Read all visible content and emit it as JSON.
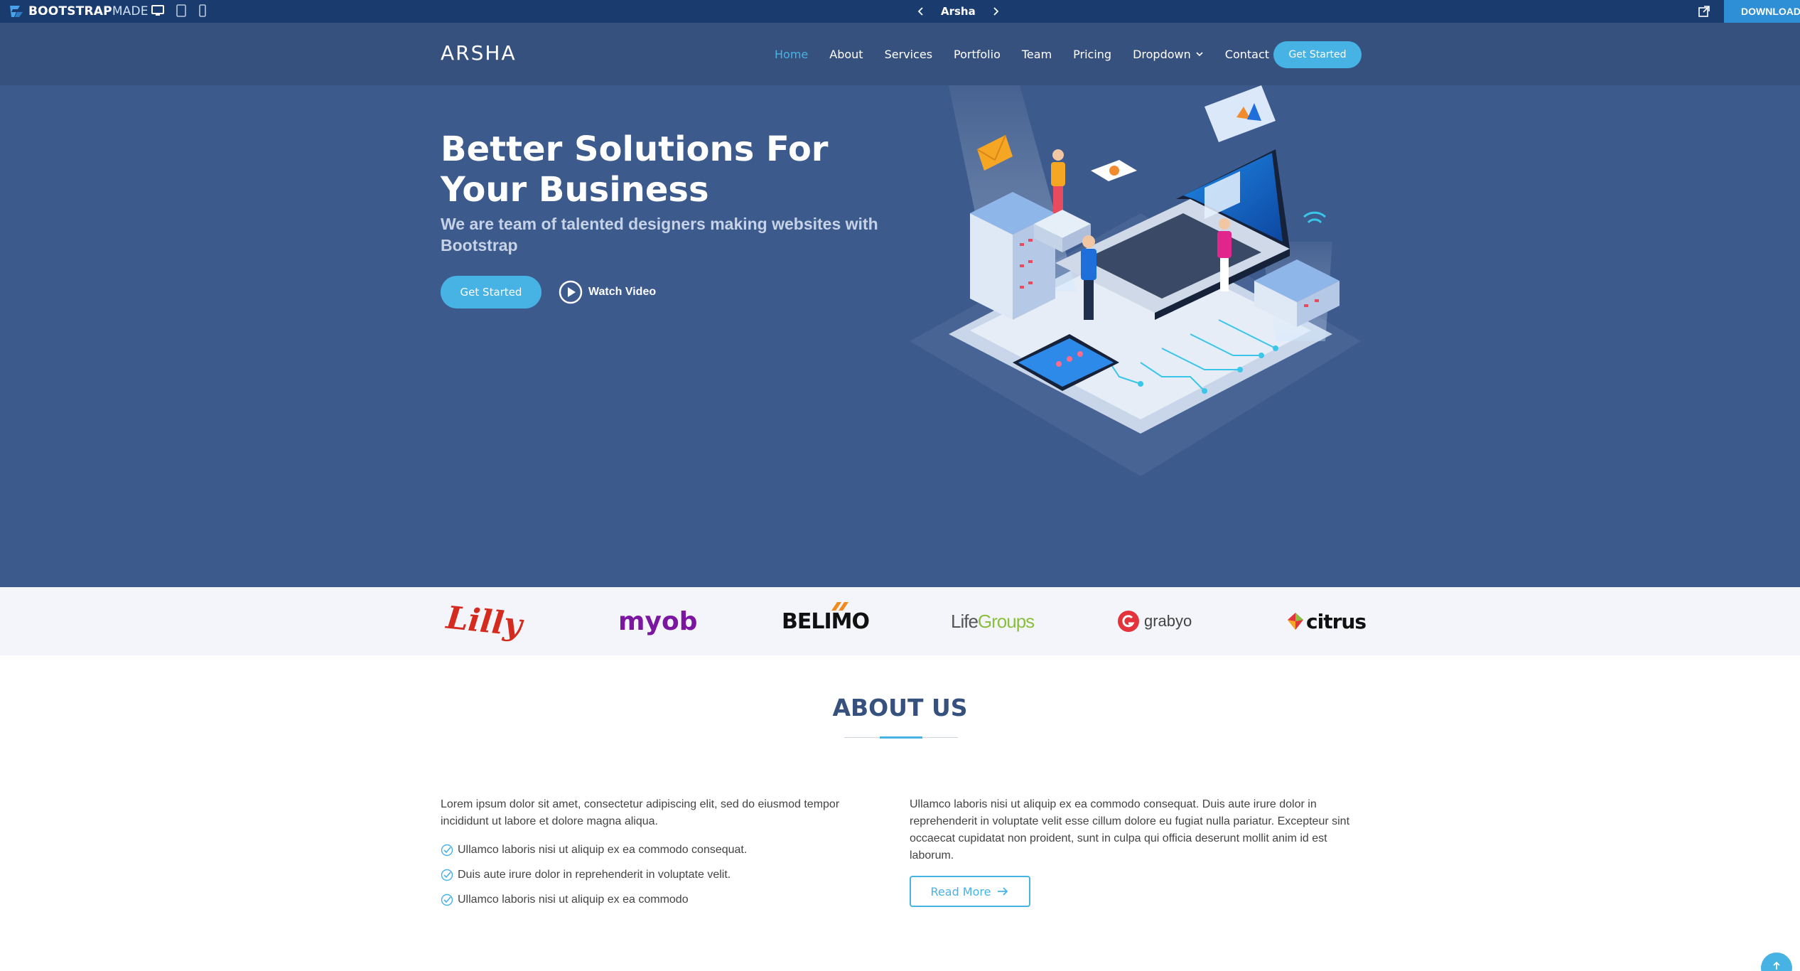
{
  "topbar": {
    "logo_bold": "BOOTSTRAP",
    "logo_light": "MADE",
    "template_name": "Arsha",
    "download_label": "DOWNLOAD",
    "colors": {
      "bar": "#1a3b6e",
      "download": "#2e8fd6"
    }
  },
  "header": {
    "brand": "ARSHA",
    "nav": [
      {
        "label": "Home",
        "active": true
      },
      {
        "label": "About"
      },
      {
        "label": "Services"
      },
      {
        "label": "Portfolio"
      },
      {
        "label": "Team"
      },
      {
        "label": "Pricing"
      },
      {
        "label": "Dropdown",
        "has_caret": true
      },
      {
        "label": "Contact"
      }
    ],
    "cta": "Get Started"
  },
  "hero": {
    "title": "Better Solutions For Your Business",
    "subtitle": "We are team of talented designers making websites with Bootstrap",
    "cta": "Get Started",
    "watch_video": "Watch Video"
  },
  "clients": [
    {
      "name": "Lilly",
      "color": "#d52b1e"
    },
    {
      "name": "myob",
      "color": "#7b16a1"
    },
    {
      "name": "BELIMO",
      "color": "#111111"
    },
    {
      "name": "Life",
      "name2": "Groups",
      "color": "#555555",
      "color2": "#8bbf3f"
    },
    {
      "name": "grabyo",
      "color": "#444444",
      "icon_letter": "G"
    },
    {
      "name": "citrus",
      "color": "#111111"
    }
  ],
  "about": {
    "title": "ABOUT US",
    "left_paragraph": "Lorem ipsum dolor sit amet, consectetur adipiscing elit, sed do eiusmod tempor incididunt ut labore et dolore magna aliqua.",
    "checks": [
      "Ullamco laboris nisi ut aliquip ex ea commodo consequat.",
      "Duis aute irure dolor in reprehenderit in voluptate velit.",
      "Ullamco laboris nisi ut aliquip ex ea commodo"
    ],
    "right_paragraph": "Ullamco laboris nisi ut aliquip ex ea commodo consequat. Duis aute irure dolor in reprehenderit in voluptate velit esse cillum dolore eu fugiat nulla pariatur. Excepteur sint occaecat cupidatat non proident, sunt in culpa qui officia deserunt mollit anim id est laborum.",
    "read_more": "Read More"
  },
  "colors": {
    "primary": "#47b2e4",
    "header_bg": "#37517e",
    "hero_bg": "#3d5a8c",
    "heading": "#37517e"
  },
  "icons": [
    "desktop-icon",
    "tablet-icon",
    "mobile-icon",
    "chevron-left-icon",
    "chevron-right-icon",
    "external-link-icon",
    "download-icon",
    "chevron-down-icon",
    "play-circle-icon",
    "check-circle-icon",
    "arrow-right-icon",
    "arrow-up-icon"
  ]
}
